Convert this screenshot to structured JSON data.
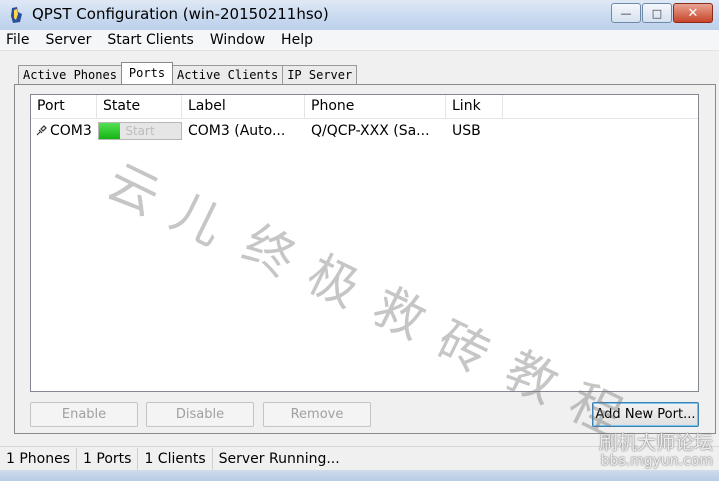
{
  "window": {
    "title": "QPST Configuration (win-20150211hso)",
    "minimize_glyph": "—",
    "maximize_glyph": "□",
    "close_glyph": "✕"
  },
  "menu": [
    "File",
    "Server",
    "Start Clients",
    "Window",
    "Help"
  ],
  "tabs": [
    {
      "label": "Active Phones",
      "active": false
    },
    {
      "label": "Ports",
      "active": true
    },
    {
      "label": "Active Clients",
      "active": false
    },
    {
      "label": "IP Server",
      "active": false
    }
  ],
  "list": {
    "columns": [
      "Port",
      "State",
      "Label",
      "Phone",
      "Link"
    ],
    "rows": [
      {
        "port": "COM3",
        "port_icon": "usb-plug-icon",
        "state": "Start",
        "state_progress": 0.25,
        "label": "COM3 (Auto...",
        "phone": "Q/QCP-XXX (Sa...",
        "link": "USB"
      }
    ]
  },
  "buttons": {
    "enable": "Enable",
    "disable": "Disable",
    "remove": "Remove",
    "add_new_port": "Add New Port..."
  },
  "status_bar": [
    "1 Phones",
    "1 Ports",
    "1 Clients",
    "Server Running..."
  ],
  "watermark": {
    "diagonal": [
      "云",
      "儿",
      "终",
      "极",
      "救",
      "砖",
      "教",
      "程"
    ],
    "corner_line1": "刷机大师论坛",
    "corner_line2": "bbs.mgyun.com"
  },
  "colors": {
    "progress_green": "#15b415",
    "titlebar": "#c9daf0",
    "close_button": "#c7452a"
  }
}
